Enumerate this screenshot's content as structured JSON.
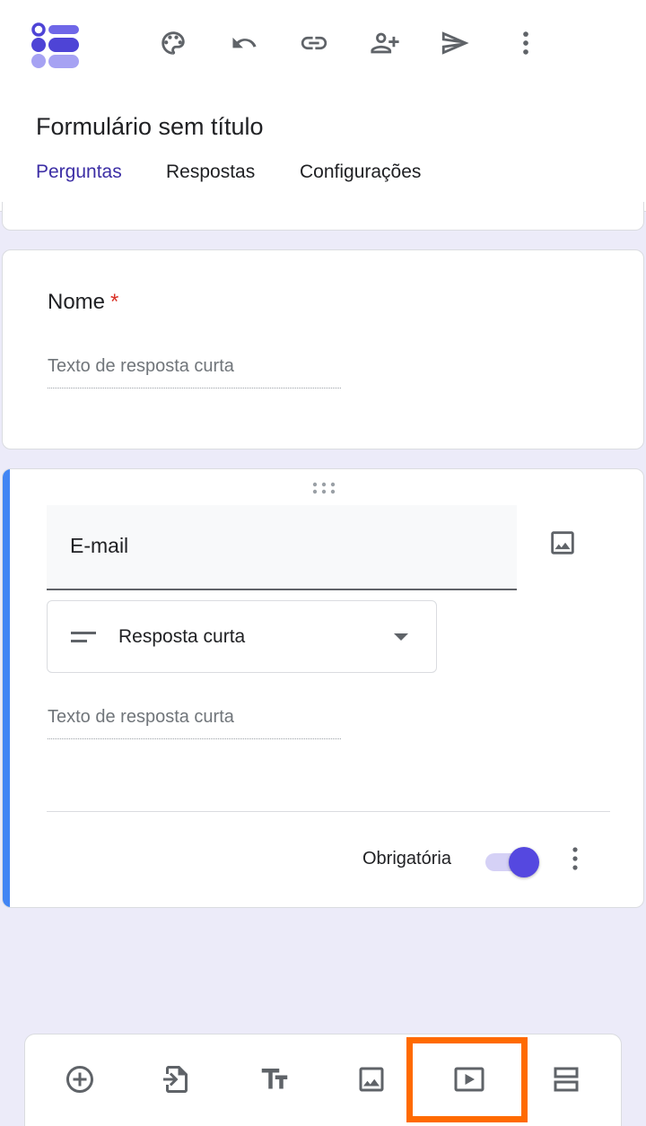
{
  "header": {
    "form_title": "Formulário sem título",
    "toolbar_icons": [
      "palette-icon",
      "undo-icon",
      "link-icon",
      "add-collaborator-icon",
      "send-icon",
      "more-vert-icon"
    ]
  },
  "tabs": [
    {
      "label": "Perguntas",
      "active": true
    },
    {
      "label": "Respostas",
      "active": false
    },
    {
      "label": "Configurações",
      "active": false
    }
  ],
  "questions": [
    {
      "title": "Nome",
      "required_mark": "*",
      "answer_placeholder": "Texto de resposta curta"
    },
    {
      "title": "E-mail",
      "type": "Resposta curta",
      "answer_placeholder": "Texto de resposta curta",
      "required_label": "Obrigatória",
      "required": true
    }
  ],
  "bottom_toolbar": {
    "icons": [
      "add-question-icon",
      "import-questions-icon",
      "add-title-icon",
      "add-image-icon",
      "add-video-icon",
      "add-section-icon"
    ],
    "highlighted": "add-video-icon"
  },
  "colors": {
    "accent": "#3c2ea5",
    "toggle": "#5548e0",
    "card_active_border": "#4285f4",
    "highlight": "#ff6a00",
    "background": "#ecebf9"
  }
}
